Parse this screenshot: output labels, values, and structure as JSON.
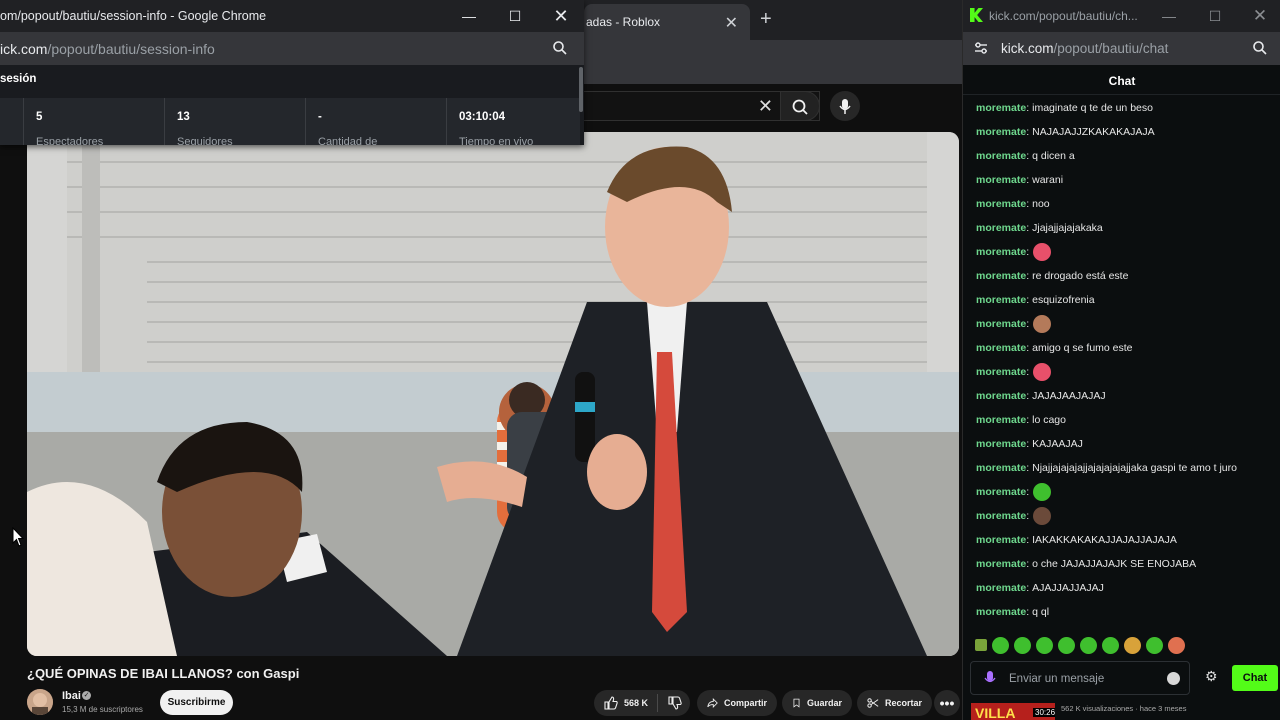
{
  "background_browser": {
    "tab_title": "adas - Roblox",
    "tab_close": "✕",
    "new_tab": "+",
    "search_clear": "✕"
  },
  "video": {
    "title": "¿QUÉ OPINAS DE IBAI LLANOS? con Gaspi",
    "channel_name": "Ibai",
    "subscribers": "15,3 M de suscriptores",
    "subscribe_label": "Suscribirme",
    "like_count": "568 K",
    "share_label": "Compartir",
    "save_label": "Guardar",
    "clip_label": "Recortar",
    "more_label": "•••"
  },
  "session_popout": {
    "window_title": "om/popout/bautiu/session-info - Google Chrome",
    "url_host": "ick.com",
    "url_path": "/popout/bautiu/session-info",
    "heading": "sesión",
    "min_glyph": "—",
    "max_glyph": "☐",
    "close_glyph": "✕",
    "stats": [
      {
        "value": "5",
        "label": "Espectadores"
      },
      {
        "value": "13",
        "label": "Seguidores"
      },
      {
        "value": "-",
        "label": "Cantidad de"
      },
      {
        "value": "03:10:04",
        "label": "Tiempo en vivo"
      }
    ]
  },
  "kick_chat": {
    "window_title": "kick.com/popout/bautiu/ch...",
    "url_host": "kick.com",
    "url_path": "/popout/bautiu/chat",
    "min_glyph": "—",
    "max_glyph": "☐",
    "close_glyph": "✕",
    "chat_title": "Chat",
    "messages": [
      {
        "user": "moremate",
        "text": "imaginate q te de un beso"
      },
      {
        "user": "moremate",
        "text": "NAJAJAJJZKAKAKAJAJA"
      },
      {
        "user": "moremate",
        "text": "q dicen a"
      },
      {
        "user": "moremate",
        "text": "warani"
      },
      {
        "user": "moremate",
        "text": "noo"
      },
      {
        "user": "moremate",
        "text": "Jjajajjajajakaka"
      },
      {
        "user": "moremate",
        "text": "",
        "emote": "#e8506a"
      },
      {
        "user": "moremate",
        "text": "re drogado está este"
      },
      {
        "user": "moremate",
        "text": "esquizofrenia"
      },
      {
        "user": "moremate",
        "text": "",
        "emote": "#b47a5a"
      },
      {
        "user": "moremate",
        "text": "amigo q se fumo este"
      },
      {
        "user": "moremate",
        "text": "",
        "emote": "#e8506a"
      },
      {
        "user": "moremate",
        "text": "JAJAJAAJAJAJ"
      },
      {
        "user": "moremate",
        "text": "lo cago"
      },
      {
        "user": "moremate",
        "text": "KAJAAJAJ"
      },
      {
        "user": "moremate",
        "text": "Njajjajajajajjajajajajajjaka gaspi te amo t juro"
      },
      {
        "user": "moremate",
        "text": "",
        "emote": "#3fbf2e"
      },
      {
        "user": "moremate",
        "text": "",
        "emote": "#6b4a3a"
      },
      {
        "user": "moremate",
        "text": "IAKAKKAKAKAJJAJAJJAJAJA"
      },
      {
        "user": "moremate",
        "text": "o che JAJAJJAJAJK SE ENOJABA"
      },
      {
        "user": "moremate",
        "text": "AJAJJAJJAJAJ"
      },
      {
        "user": "moremate",
        "text": "q ql"
      }
    ],
    "input_placeholder": "Enviar un mensaje",
    "send_label": "Chat",
    "gear_glyph": "⚙",
    "thumb_text": "VILLA",
    "thumb_duration": "30:26",
    "thumb_meta": "562 K visualizaciones · hace 3 meses",
    "accent_color": "#53fc18",
    "username_color": "#6fd88e"
  }
}
